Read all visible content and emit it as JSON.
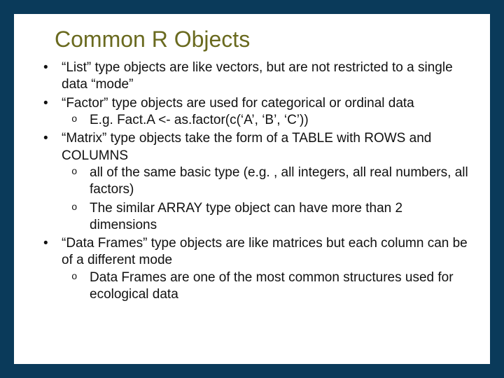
{
  "title": "Common R Objects",
  "bullets": [
    {
      "text": "“List” type objects are like vectors, but are not restricted to a single data “mode”",
      "sub": []
    },
    {
      "text": "“Factor” type objects are used for categorical or ordinal data",
      "sub": [
        "E.g. Fact.A <- as.factor(c(‘A’, ‘B’, ‘C’))"
      ]
    },
    {
      "text": "“Matrix” type objects take the form of a TABLE with ROWS and COLUMNS",
      "sub": [
        "all of the same basic type (e.g. , all integers, all real numbers, all factors)",
        "The similar ARRAY type object can have more than 2 dimensions"
      ]
    },
    {
      "text": "“Data Frames” type objects are like matrices but each column can be of a different mode",
      "sub": [
        "Data Frames are one of the most common structures used for ecological data"
      ]
    }
  ]
}
